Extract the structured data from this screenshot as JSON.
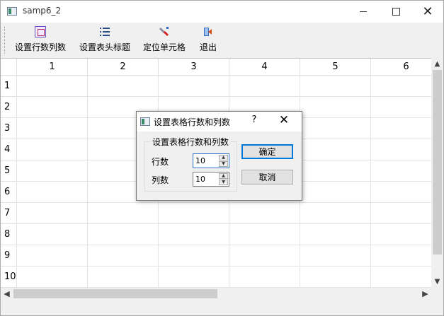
{
  "window": {
    "title": "samp6_2"
  },
  "toolbar": {
    "buttons": [
      {
        "label": "设置行数列数",
        "icon": "grid-icon"
      },
      {
        "label": "设置表头标题",
        "icon": "list-icon"
      },
      {
        "label": "定位单元格",
        "icon": "locate-cell-icon"
      },
      {
        "label": "退出",
        "icon": "exit-icon"
      }
    ]
  },
  "table": {
    "columns": [
      "1",
      "2",
      "3",
      "4",
      "5",
      "6"
    ],
    "rows": [
      "1",
      "2",
      "3",
      "4",
      "5",
      "6",
      "7",
      "8",
      "9",
      "10"
    ]
  },
  "dialog": {
    "title": "设置表格行数和列数",
    "help": "?",
    "group_title": "设置表格行数和列数",
    "rows_label": "行数",
    "rows_value": "10",
    "cols_label": "列数",
    "cols_value": "10",
    "ok_label": "确定",
    "cancel_label": "取消"
  },
  "colors": {
    "accent": "#0078d7",
    "thumb": "#cdcdcd"
  }
}
